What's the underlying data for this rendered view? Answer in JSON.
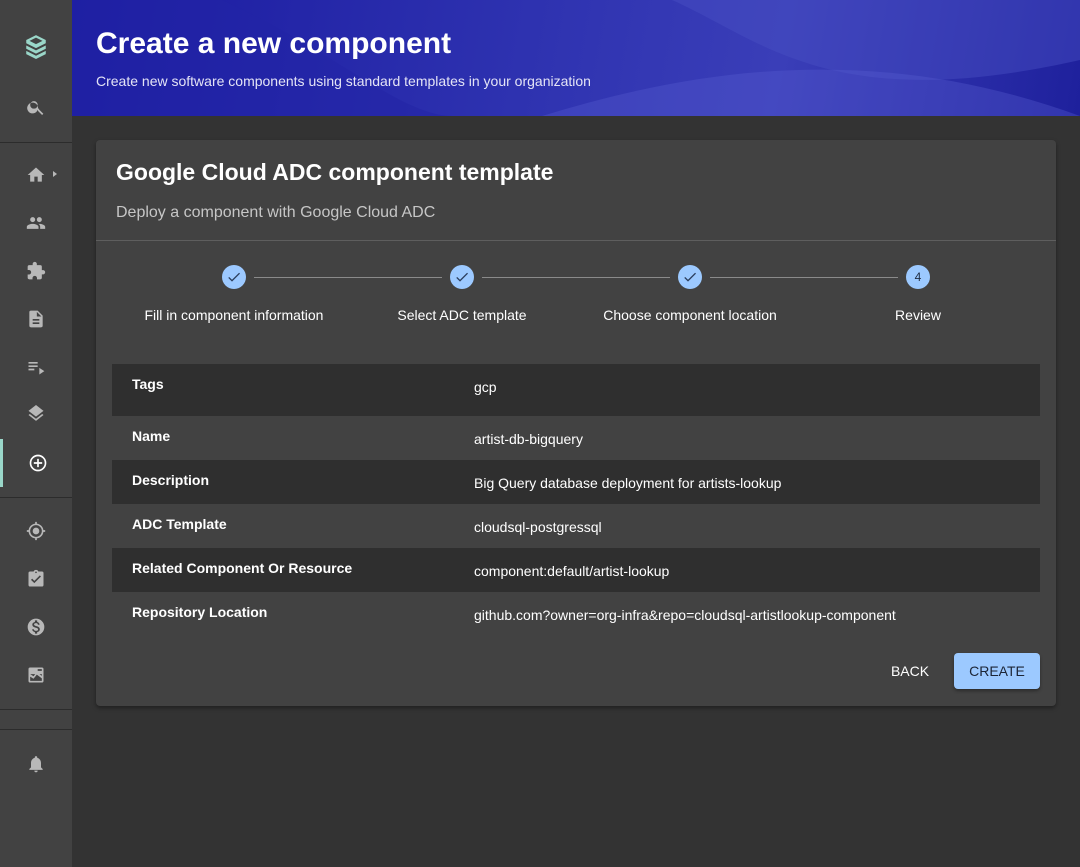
{
  "header": {
    "title": "Create a new component",
    "subtitle": "Create new software components using standard templates in your organization"
  },
  "sidebar": {
    "items": [
      {
        "icon": "logo-icon"
      },
      {
        "icon": "search-icon"
      },
      {
        "icon": "home-icon"
      },
      {
        "icon": "groups-icon"
      },
      {
        "icon": "extension-icon"
      },
      {
        "icon": "document-icon"
      },
      {
        "icon": "playlist-icon"
      },
      {
        "icon": "layers-icon"
      },
      {
        "icon": "create-icon",
        "active": true
      },
      {
        "icon": "gps-icon"
      },
      {
        "icon": "assignment-check-icon"
      },
      {
        "icon": "dollar-icon"
      },
      {
        "icon": "score-icon"
      },
      {
        "icon": "notifications-icon"
      }
    ]
  },
  "card": {
    "title": "Google Cloud ADC component template",
    "subtitle": "Deploy a component with Google Cloud ADC"
  },
  "steps": [
    {
      "label": "Fill in component information",
      "state": "done"
    },
    {
      "label": "Select ADC template",
      "state": "done"
    },
    {
      "label": "Choose component location",
      "state": "done"
    },
    {
      "label": "Review",
      "state": "active",
      "number": "4"
    }
  ],
  "review": [
    {
      "key": "Tags",
      "value": "gcp"
    },
    {
      "key": "Name",
      "value": "artist-db-bigquery"
    },
    {
      "key": "Description",
      "value": "Big Query database deployment for artists-lookup"
    },
    {
      "key": "ADC Template",
      "value": "cloudsql-postgressql"
    },
    {
      "key": "Related Component Or Resource",
      "value": "component:default/artist-lookup"
    },
    {
      "key": "Repository Location",
      "value": "github.com?owner=org-infra&repo=cloudsql-artistlookup-component"
    }
  ],
  "actions": {
    "back": "Back",
    "create": "Create"
  },
  "colors": {
    "accent": "#9cc9ff",
    "header_start": "#1a1aa0",
    "header_end": "#3a3eb8",
    "active_indicator": "#9ad7c9"
  }
}
